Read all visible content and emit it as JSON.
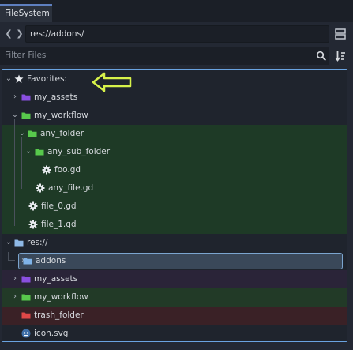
{
  "dock": {
    "tab_label": "FileSystem"
  },
  "nav": {
    "back": "❮",
    "forward": "❯",
    "path": "res://addons/"
  },
  "filter": {
    "placeholder": "Filter Files"
  },
  "tree": {
    "favorites_label": "Favorites:",
    "res_label": "res://",
    "items": [
      {
        "label": "my_assets",
        "color": "#8a4fe0"
      },
      {
        "label": "my_workflow",
        "color": "#58c94c"
      },
      {
        "label": "any_folder",
        "color": "#58c94c"
      },
      {
        "label": "any_sub_folder",
        "color": "#58c94c"
      },
      {
        "label": "foo.gd"
      },
      {
        "label": "any_file.gd"
      },
      {
        "label": "file_0.gd"
      },
      {
        "label": "file_1.gd"
      },
      {
        "label": "addons",
        "color": "#7fb3e8"
      },
      {
        "label": "my_assets",
        "color": "#8a4fe0"
      },
      {
        "label": "my_workflow",
        "color": "#58c94c"
      },
      {
        "label": "trash_folder",
        "color": "#e04848"
      },
      {
        "label": "icon.svg"
      }
    ]
  },
  "colors": {
    "accent": "#6aa3e0",
    "annotation_arrow": "#d7f24a"
  }
}
